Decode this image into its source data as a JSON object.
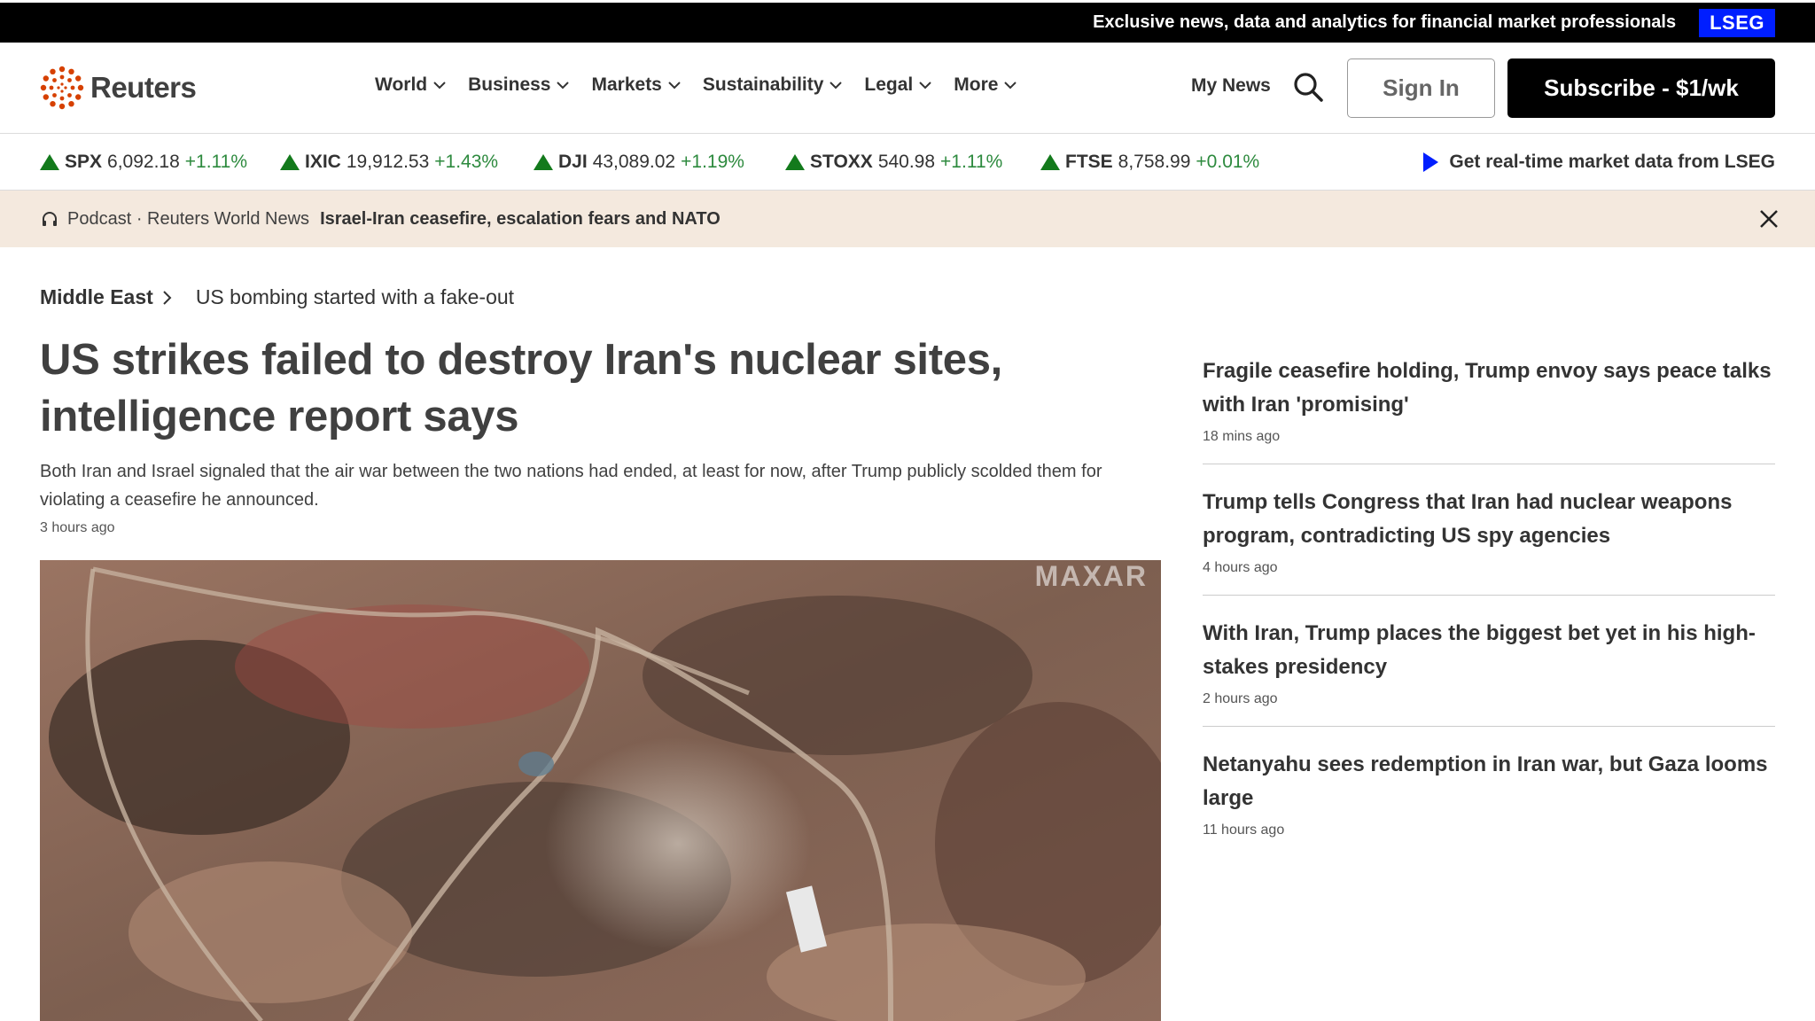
{
  "promo": {
    "text": "Exclusive news, data and analytics for financial market professionals",
    "badge": "LSEG"
  },
  "header": {
    "logo_text": "Reuters",
    "nav": [
      "World",
      "Business",
      "Markets",
      "Sustainability",
      "Legal",
      "More"
    ],
    "my_news": "My News",
    "sign_in": "Sign In",
    "subscribe": "Subscribe - $1/wk"
  },
  "ticker": {
    "items": [
      {
        "symbol": "SPX",
        "value": "6,092.18",
        "change": "+1.11%"
      },
      {
        "symbol": "IXIC",
        "value": "19,912.53",
        "change": "+1.43%"
      },
      {
        "symbol": "DJI",
        "value": "43,089.02",
        "change": "+1.19%"
      },
      {
        "symbol": "STOXX",
        "value": "540.98",
        "change": "+1.11%"
      },
      {
        "symbol": "FTSE",
        "value": "8,758.99",
        "change": "+0.01%"
      }
    ],
    "realtime": "Get real-time market data from LSEG",
    "colors": {
      "up": "#137a1c",
      "lseg": "#001eff"
    }
  },
  "podcast": {
    "label": "Podcast · Reuters World News",
    "title": "Israel-Iran ceasefire, escalation fears and NATO"
  },
  "breadcrumb": {
    "section": "Middle East",
    "story": "US bombing started with a fake-out"
  },
  "main": {
    "headline": "US strikes failed to destroy Iran's nuclear sites, intelligence report says",
    "summary": "Both Iran and Israel signaled that the air war between the two nations had ended, at least for now, after Trump publicly scolded them for violating a ceasefire he announced.",
    "time": "3 hours ago",
    "image_watermark": "MAXAR"
  },
  "sidebar": [
    {
      "title": "Fragile ceasefire holding, Trump envoy says peace talks with Iran 'promising'",
      "time": "18 mins ago"
    },
    {
      "title": "Trump tells Congress that Iran had nuclear weapons program, contradicting US spy agencies",
      "time": "4 hours ago"
    },
    {
      "title": "With Iran, Trump places the biggest bet yet in his high-stakes presidency",
      "time": "2 hours ago"
    },
    {
      "title": "Netanyahu sees redemption in Iran war, but Gaza looms large",
      "time": "11 hours ago"
    }
  ]
}
